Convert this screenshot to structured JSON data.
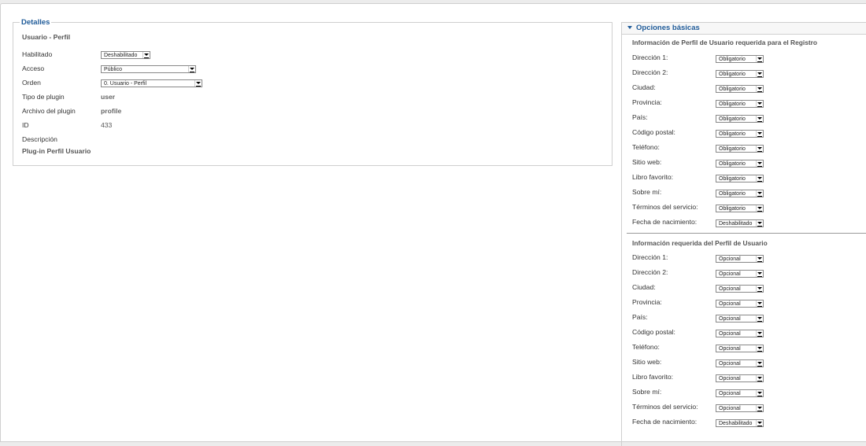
{
  "details": {
    "legend": "Detalles",
    "subtitle": "Usuario - Perfil",
    "habilitado_label": "Habilitado",
    "habilitado_value": "Deshabilitado",
    "acceso_label": "Acceso",
    "acceso_value": "Público",
    "orden_label": "Orden",
    "orden_value": "0. Usuario - Perfil",
    "tipo_label": "Tipo de plugin",
    "tipo_value": "user",
    "archivo_label": "Archivo del plugin",
    "archivo_value": "profile",
    "id_label": "ID",
    "id_value": "433",
    "descripcion_label": "Descripción",
    "descripcion_value": "Plug-in Perfil Usuario"
  },
  "panel": {
    "title": "Opciones básicas",
    "registro": {
      "title": "Información de Perfil de Usuario requerida para el Registro",
      "rows": [
        {
          "label": "Dirección 1:",
          "value": "Obligatorio"
        },
        {
          "label": "Dirección 2:",
          "value": "Obligatorio"
        },
        {
          "label": "Ciudad:",
          "value": "Obligatorio"
        },
        {
          "label": "Provincia:",
          "value": "Obligatorio"
        },
        {
          "label": "País:",
          "value": "Obligatorio"
        },
        {
          "label": "Código postal:",
          "value": "Obligatorio"
        },
        {
          "label": "Teléfono:",
          "value": "Obligatorio"
        },
        {
          "label": "Sitio web:",
          "value": "Obligatorio"
        },
        {
          "label": "Libro favorito:",
          "value": "Obligatorio"
        },
        {
          "label": "Sobre mí:",
          "value": "Obligatorio"
        },
        {
          "label": "Términos del servicio:",
          "value": "Obligatorio"
        },
        {
          "label": "Fecha de nacimiento:",
          "value": "Deshabilitado"
        }
      ]
    },
    "perfil": {
      "title": "Información requerida del Perfil de Usuario",
      "rows": [
        {
          "label": "Dirección 1:",
          "value": "Opcional"
        },
        {
          "label": "Dirección 2:",
          "value": "Opcional"
        },
        {
          "label": "Ciudad:",
          "value": "Opcional"
        },
        {
          "label": "Provincia:",
          "value": "Opcional"
        },
        {
          "label": "País:",
          "value": "Opcional"
        },
        {
          "label": "Código postal:",
          "value": "Opcional"
        },
        {
          "label": "Teléfono:",
          "value": "Opcional"
        },
        {
          "label": "Sitio web:",
          "value": "Opcional"
        },
        {
          "label": "Libro favorito:",
          "value": "Opcional"
        },
        {
          "label": "Sobre mí:",
          "value": "Opcional"
        },
        {
          "label": "Términos del servicio:",
          "value": "Opcional"
        },
        {
          "label": "Fecha de nacimiento:",
          "value": "Deshabilitado"
        }
      ]
    }
  }
}
